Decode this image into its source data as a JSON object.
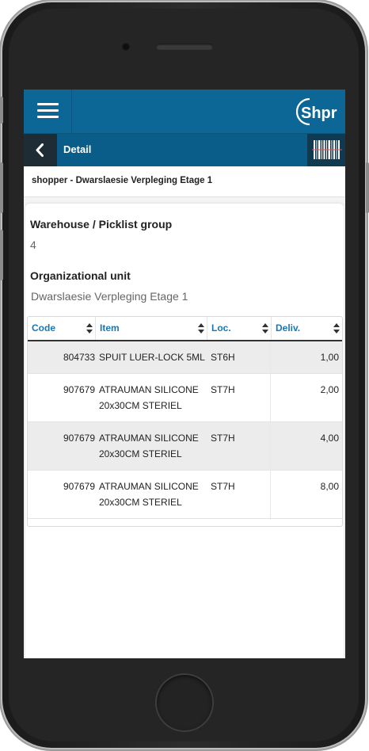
{
  "app": {
    "logo_text": "Shpr",
    "page_title": "Detail",
    "subheader": "shopper - Dwarslaesie Verpleging Etage 1"
  },
  "fields": [
    {
      "label": "Warehouse / Picklist group",
      "value": "4"
    },
    {
      "label": "Organizational unit",
      "value": "Dwarslaesie Verpleging Etage 1"
    }
  ],
  "table": {
    "columns": [
      "Code",
      "Item",
      "Loc.",
      "Deliv."
    ],
    "rows": [
      {
        "code": "804733",
        "item": "SPUIT LUER-LOCK 5ML",
        "loc": "ST6H",
        "deliv": "1,00"
      },
      {
        "code": "907679",
        "item": "ATRAUMAN SILICONE 20x30CM STERIEL",
        "loc": "ST7H",
        "deliv": "2,00"
      },
      {
        "code": "907679",
        "item": "ATRAUMAN SILICONE 20x30CM STERIEL",
        "loc": "ST7H",
        "deliv": "4,00"
      },
      {
        "code": "907679",
        "item": "ATRAUMAN SILICONE 20x30CM STERIEL",
        "loc": "ST7H",
        "deliv": "8,00"
      }
    ]
  },
  "icons": [
    "hamburger-menu-icon",
    "back-chevron-icon",
    "barcode-scan-icon",
    "sort-icon"
  ],
  "colors": {
    "topbar": "#0c6796",
    "titlebar": "#0a5d88",
    "accent": "#1b76b5"
  }
}
